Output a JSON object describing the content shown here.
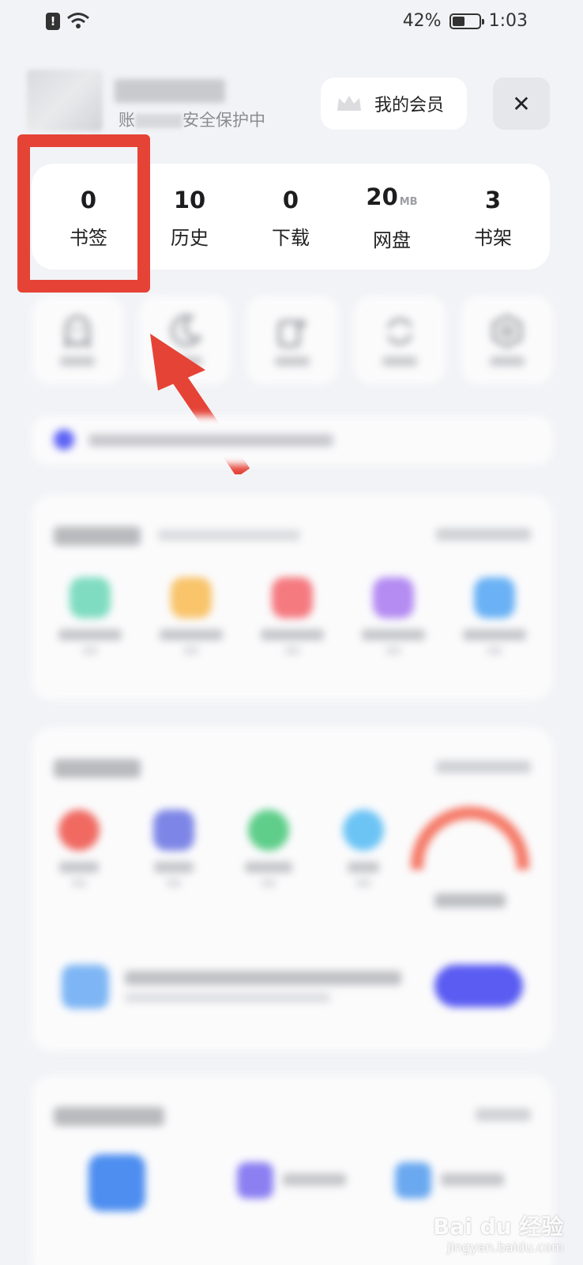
{
  "status_bar": {
    "battery_percent": "42%",
    "battery_level": 0.42,
    "time": "1:03"
  },
  "header": {
    "subline": "安全保护中",
    "subline_prefix": "账",
    "vip_label": "我的会员",
    "close_label": "✕"
  },
  "stats": [
    {
      "value": "0",
      "unit": "",
      "label": "书签"
    },
    {
      "value": "10",
      "unit": "",
      "label": "历史"
    },
    {
      "value": "0",
      "unit": "",
      "label": "下载"
    },
    {
      "value": "20",
      "unit": "MB",
      "label": "网盘"
    },
    {
      "value": "3",
      "unit": "",
      "label": "书架"
    }
  ],
  "quick_icons": [
    "ghost-icon",
    "moon-icon",
    "sparkle-card-icon",
    "refresh-icon",
    "settings-hexagon-icon"
  ],
  "colors": {
    "highlight": "#e54336",
    "accent": "#5a5cf2",
    "grid_icons": [
      "#7fdcc0",
      "#f9c46a",
      "#f57a80",
      "#b48cf2",
      "#6ab2f5"
    ],
    "tools_icons": [
      "#f06a62",
      "#7d86e6",
      "#5fce8a",
      "#6cc4f5"
    ]
  },
  "watermark": {
    "brand": "Bai du 经验",
    "url": "jingyan.baidu.com"
  }
}
